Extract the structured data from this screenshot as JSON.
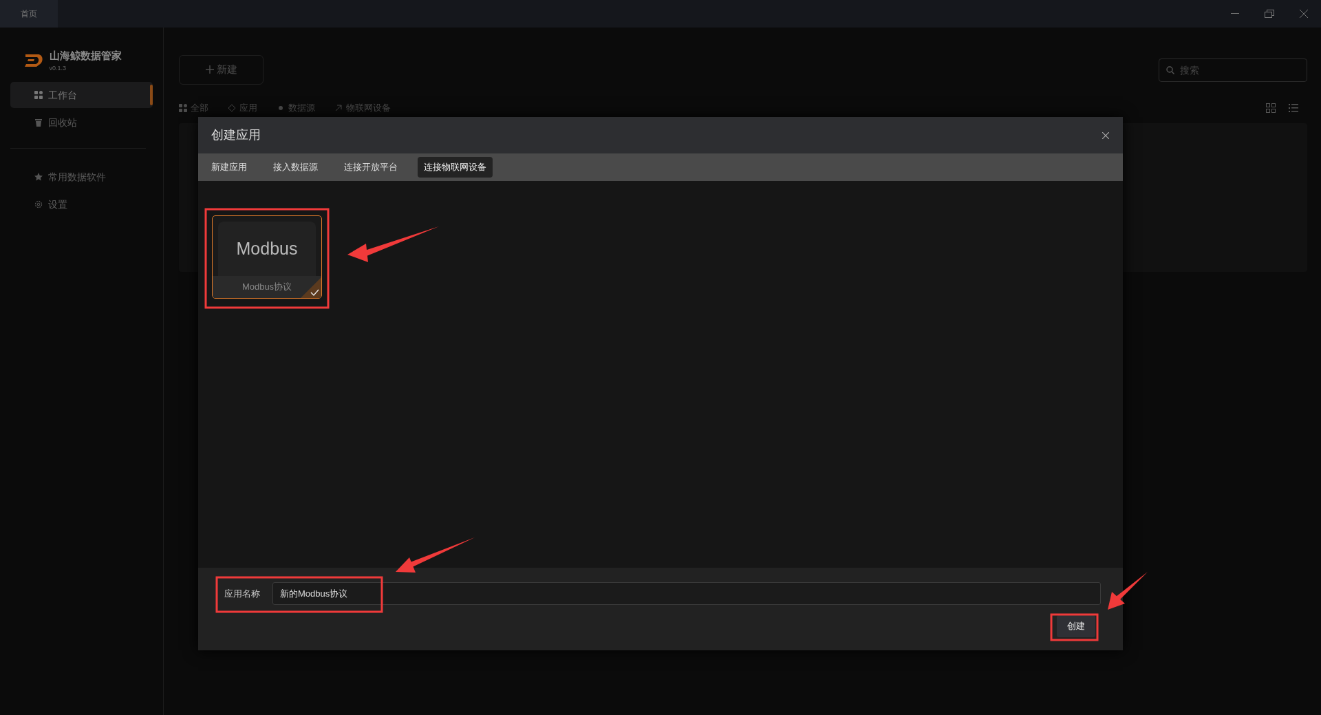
{
  "title_bar": {
    "tabs": [
      {
        "label": "首页"
      }
    ]
  },
  "sidebar": {
    "app_name": "山海鲸数据管家",
    "version": "v0.1.3",
    "items": [
      {
        "kind": "grid",
        "label": "工作台",
        "selected": true
      },
      {
        "kind": "trash",
        "label": "回收站",
        "selected": false
      }
    ],
    "bottom_items": [
      {
        "kind": "star",
        "label": "常用数据软件"
      },
      {
        "kind": "gear",
        "label": "设置"
      }
    ]
  },
  "main": {
    "new_button": "新建",
    "search": {
      "placeholder": "搜索"
    },
    "filters": [
      {
        "kind": "grid",
        "label": "全部"
      },
      {
        "kind": "app",
        "label": "应用"
      },
      {
        "kind": "source",
        "label": "数据源"
      },
      {
        "kind": "device",
        "label": "物联网设备"
      }
    ],
    "view_modes": [
      {
        "kind": "grid"
      },
      {
        "kind": "list"
      }
    ]
  },
  "dialog": {
    "title": "创建应用",
    "tabs": [
      {
        "label": "新建应用",
        "selected": false
      },
      {
        "label": "接入数据源",
        "selected": false
      },
      {
        "label": "连接开放平台",
        "selected": false
      },
      {
        "label": "连接物联网设备",
        "selected": true
      }
    ],
    "templates": [
      {
        "logo": "Modbus",
        "label": "Modbus协议",
        "selected": true
      }
    ],
    "name_field": {
      "label": "应用名称",
      "value": "新的Modbus协议"
    },
    "create_button": "创建"
  }
}
